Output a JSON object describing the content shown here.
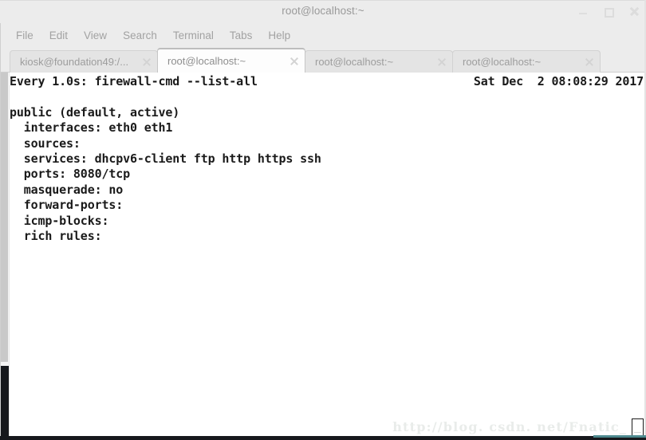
{
  "window": {
    "title": "root@localhost:~",
    "controls": {
      "minimize": "minimize",
      "maximize": "maximize",
      "close": "close"
    }
  },
  "menubar": {
    "items": [
      {
        "label": "File"
      },
      {
        "label": "Edit"
      },
      {
        "label": "View"
      },
      {
        "label": "Search"
      },
      {
        "label": "Terminal"
      },
      {
        "label": "Tabs"
      },
      {
        "label": "Help"
      }
    ]
  },
  "tabbar": {
    "tabs": [
      {
        "label": "kiosk@foundation49:/...",
        "active": false
      },
      {
        "label": "root@localhost:~",
        "active": true
      },
      {
        "label": "root@localhost:~",
        "active": false
      },
      {
        "label": "root@localhost:~",
        "active": false
      }
    ]
  },
  "terminal": {
    "watch_header": {
      "left": "Every 1.0s: firewall-cmd --list-all",
      "right": "Sat Dec  2 08:08:29 2017"
    },
    "lines": [
      "",
      "public (default, active)",
      "  interfaces: eth0 eth1",
      "  sources: ",
      "  services: dhcpv6-client ftp http https ssh",
      "  ports: 8080/tcp",
      "  masquerade: no",
      "  forward-ports: ",
      "  icmp-blocks: ",
      "  rich rules: "
    ]
  },
  "watermark": {
    "text": "http://blog. csdn. net/Fnatic_"
  },
  "colors": {
    "chrome": "#ececec",
    "terminal_bg": "#ffffff",
    "terminal_fg": "#1a1a1a",
    "tab_active_bg": "#fdfdfd",
    "accent": "#4d8a8f"
  }
}
